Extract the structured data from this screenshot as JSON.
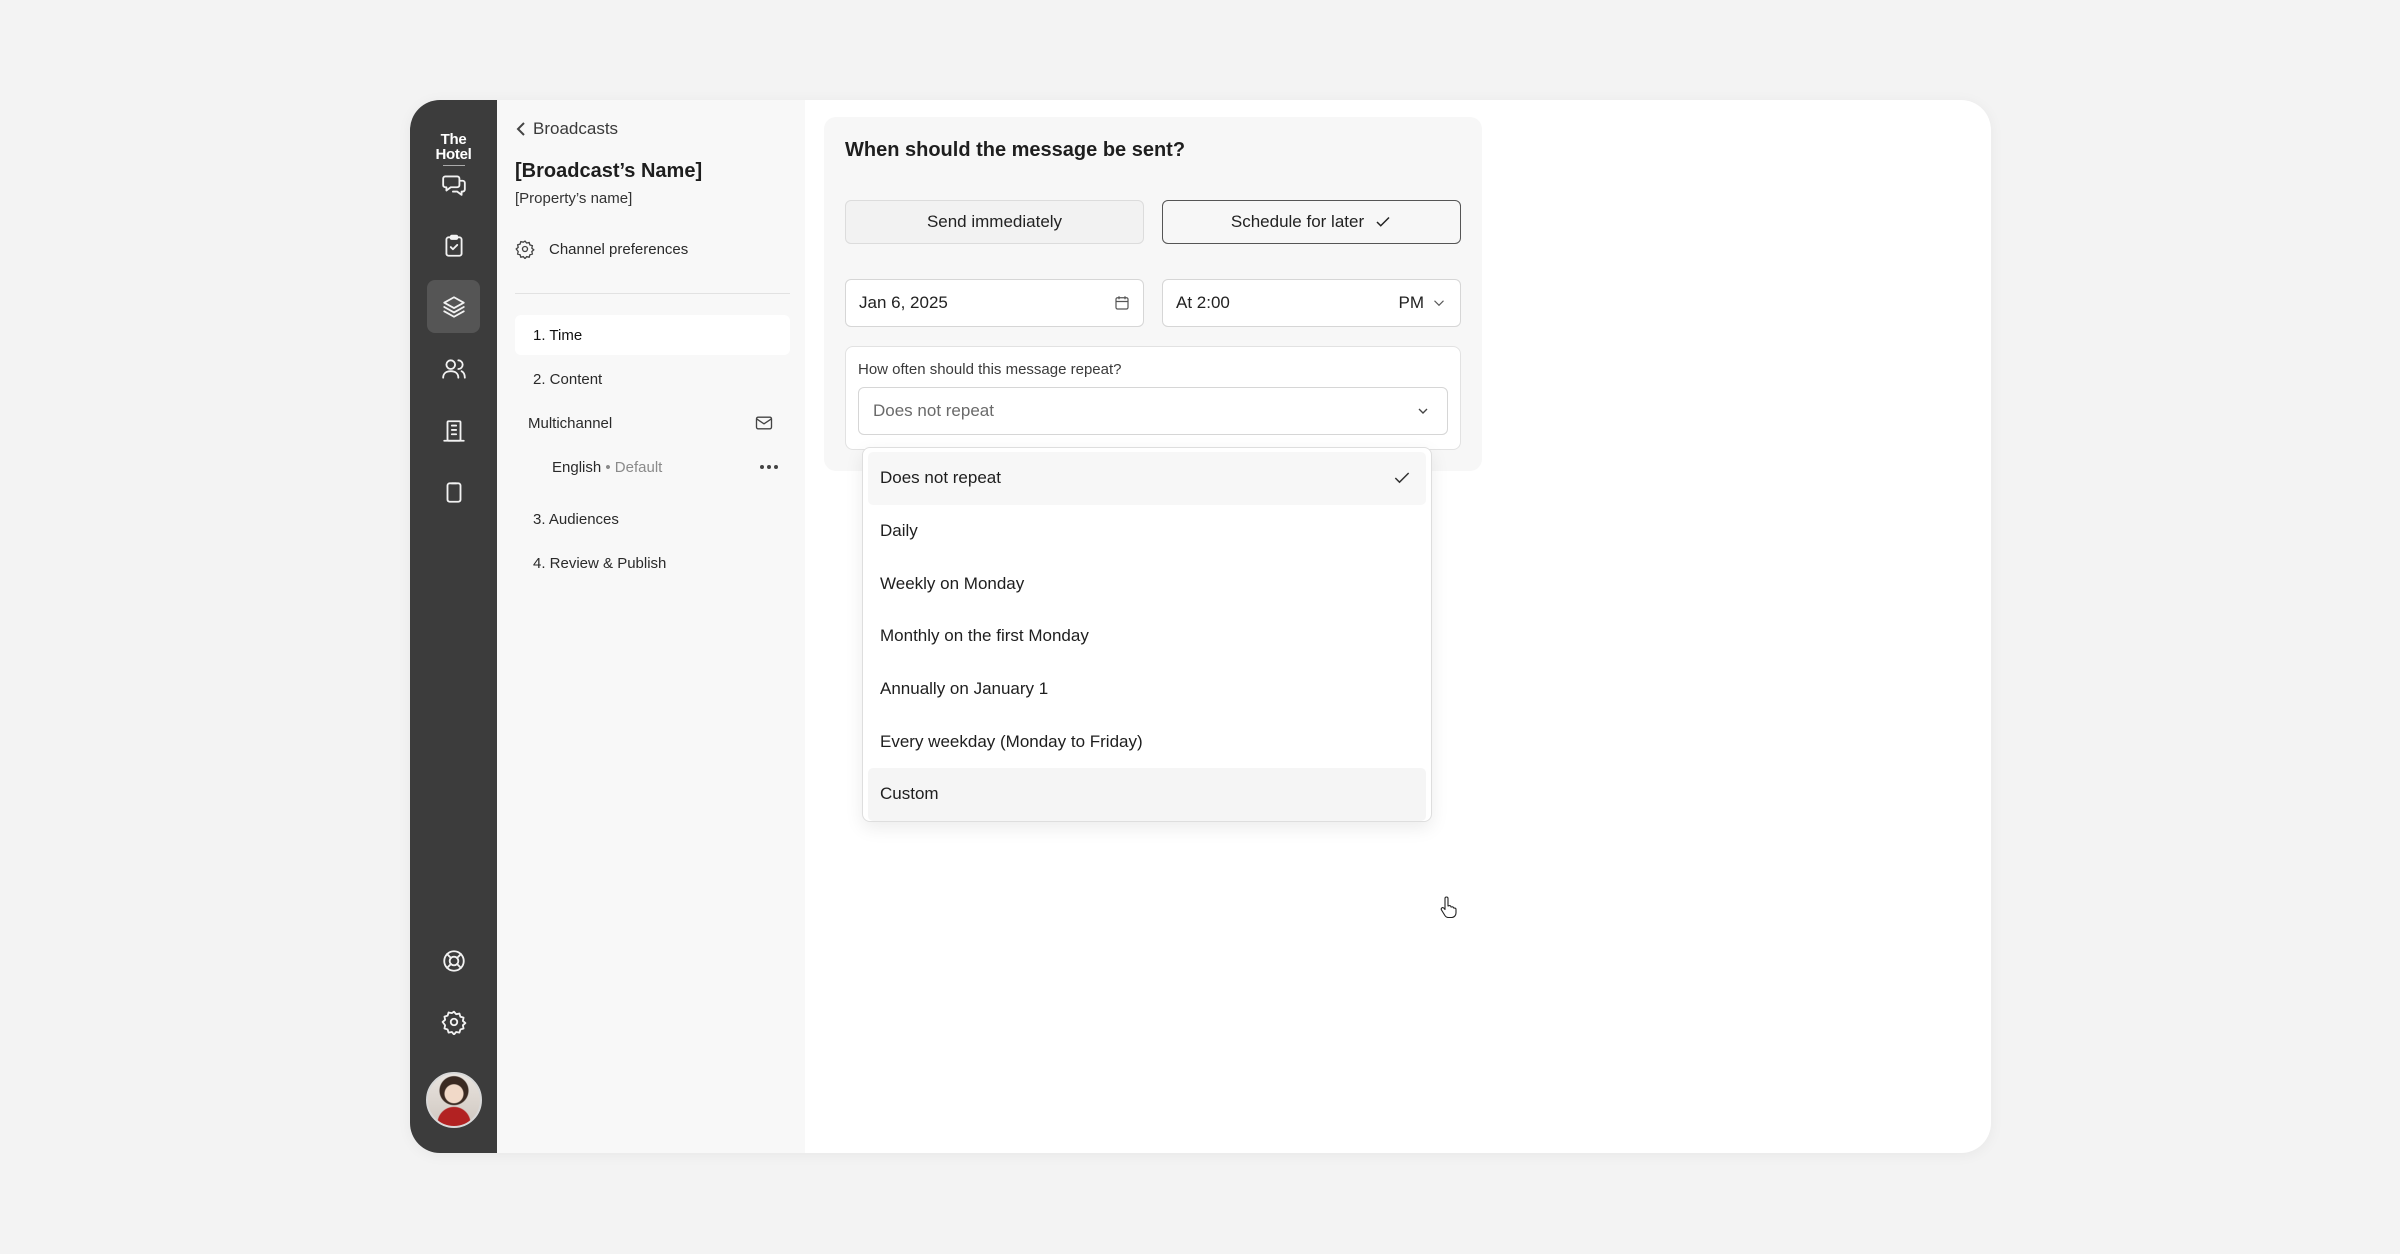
{
  "brand": {
    "logo_line1": "The",
    "logo_line2": "Hotel"
  },
  "rail": {
    "items": [
      {
        "icon": "chat-bubbles-icon"
      },
      {
        "icon": "clipboard-check-icon"
      },
      {
        "icon": "layers-icon",
        "active": true
      },
      {
        "icon": "users-icon"
      },
      {
        "icon": "building-icon"
      },
      {
        "icon": "clipboard-icon"
      }
    ],
    "bottom": [
      {
        "icon": "lifebuoy-icon"
      },
      {
        "icon": "gear-icon"
      }
    ]
  },
  "sidebar": {
    "back_label": "Broadcasts",
    "broadcast_name": "[Broadcast’s Name]",
    "property_name": "[Property’s name]",
    "channel_preferences": "Channel preferences",
    "steps": {
      "time": "1. Time",
      "content": "2. Content",
      "multichannel": "Multichannel",
      "language": "English",
      "language_suffix": " • Default",
      "audiences": "3. Audiences",
      "review": "4. Review & Publish"
    }
  },
  "main": {
    "title": "When should the message be sent?",
    "send_immediately": "Send immediately",
    "schedule_later": "Schedule for later",
    "date_value": "Jan 6, 2025",
    "time_value": "At 2:00",
    "ampm_value": "PM",
    "repeat_label": "How often should this message repeat?",
    "repeat_value": "Does not repeat",
    "repeat_options": [
      "Does not repeat",
      "Daily",
      "Weekly on Monday",
      "Monthly on the first Monday",
      "Annually on January 1",
      "Every weekday (Monday to Friday)",
      "Custom"
    ]
  },
  "colors": {
    "rail_bg": "#3c3c3c",
    "panel_bg": "#f8f8f8",
    "accent": "#555555"
  }
}
